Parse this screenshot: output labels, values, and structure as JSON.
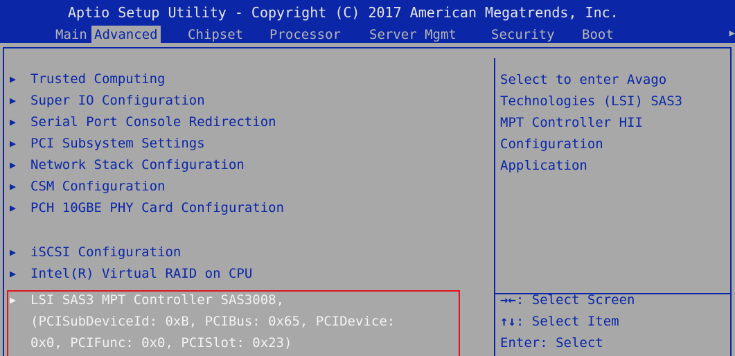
{
  "header": {
    "title": "Aptio Setup Utility - Copyright (C) 2017 American Megatrends, Inc.",
    "tabs": [
      {
        "label": "Main"
      },
      {
        "label": "Advanced"
      },
      {
        "label": "Chipset"
      },
      {
        "label": "Processor"
      },
      {
        "label": "Server Mgmt"
      },
      {
        "label": "Security"
      },
      {
        "label": "Boot"
      }
    ],
    "scroll_arrow": "▶"
  },
  "menu": {
    "arrow": "▶",
    "items": [
      {
        "label": "Trusted Computing"
      },
      {
        "label": "Super IO Configuration"
      },
      {
        "label": "Serial Port Console Redirection"
      },
      {
        "label": "PCI Subsystem Settings"
      },
      {
        "label": "Network Stack Configuration"
      },
      {
        "label": "CSM Configuration"
      },
      {
        "label": "PCH 10GBE PHY Card Configuration"
      },
      {
        "label": "iSCSI Configuration"
      },
      {
        "label": "Intel(R) Virtual RAID on CPU"
      }
    ],
    "selected": {
      "line1": "LSI SAS3 MPT Controller SAS3008,",
      "line2": "(PCISubDeviceId: 0xB, PCIBus: 0x65, PCIDevice:",
      "line3": "0x0, PCIFunc: 0x0, PCISlot: 0x23)"
    }
  },
  "help": {
    "lines": [
      "Select to enter Avago",
      "Technologies (LSI) SAS3",
      "MPT Controller HII",
      "Configuration",
      "Application"
    ]
  },
  "keys": [
    {
      "key": "→←",
      "desc": ": Select Screen"
    },
    {
      "key": "↑↓",
      "desc": ": Select Item"
    },
    {
      "key": "Enter",
      "desc": ": Select"
    }
  ],
  "colors": {
    "background": "#a8a8a8",
    "header_blue": "#0b27a8",
    "highlight_text": "#f2f2f2",
    "selection_box": "#e0141c"
  }
}
